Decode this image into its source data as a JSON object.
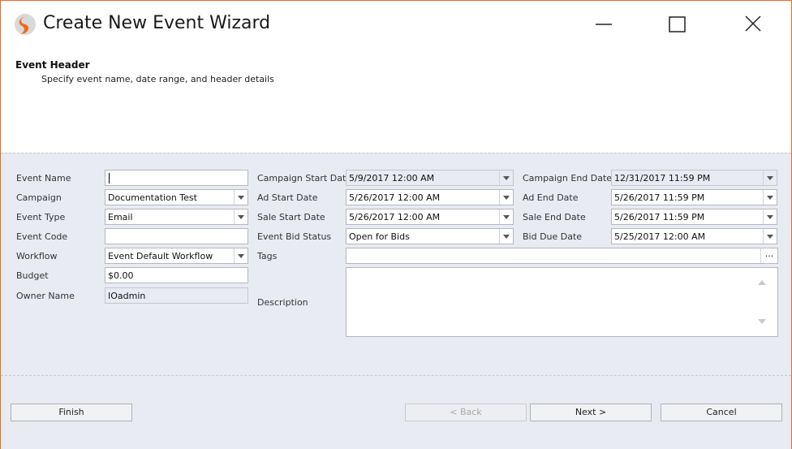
{
  "window": {
    "title": "Create New Event Wizard"
  },
  "header": {
    "title": "Event Header",
    "subtitle": "Specify event name, date range, and header details"
  },
  "form": {
    "event_name": {
      "label": "Event Name",
      "value": ""
    },
    "campaign": {
      "label": "Campaign",
      "value": "Documentation Test"
    },
    "event_type": {
      "label": "Event Type",
      "value": "Email"
    },
    "event_code": {
      "label": "Event Code",
      "value": ""
    },
    "workflow": {
      "label": "Workflow",
      "value": "Event Default Workflow"
    },
    "budget": {
      "label": "Budget",
      "value": "$0.00"
    },
    "owner_name": {
      "label": "Owner Name",
      "value": "IOadmin"
    },
    "campaign_start_date": {
      "label": "Campaign Start Date",
      "value": "5/9/2017 12:00 AM"
    },
    "ad_start_date": {
      "label": "Ad Start Date",
      "value": "5/26/2017 12:00 AM"
    },
    "sale_start_date": {
      "label": "Sale Start Date",
      "value": "5/26/2017 12:00 AM"
    },
    "event_bid_status": {
      "label": "Event Bid Status",
      "value": "Open for Bids"
    },
    "tags": {
      "label": "Tags",
      "value": ""
    },
    "description": {
      "label": "Description",
      "value": ""
    },
    "campaign_end_date": {
      "label": "Campaign End Date",
      "value": "12/31/2017 11:59 PM"
    },
    "ad_end_date": {
      "label": "Ad End Date",
      "value": "5/26/2017 11:59 PM"
    },
    "sale_end_date": {
      "label": "Sale End Date",
      "value": "5/26/2017 11:59 PM"
    },
    "bid_due_date": {
      "label": "Bid Due Date",
      "value": "5/25/2017 12:00 AM"
    }
  },
  "buttons": {
    "finish": "Finish",
    "back": "< Back",
    "next": "Next >",
    "cancel": "Cancel",
    "tags_ellipsis": "..."
  },
  "colors": {
    "accent": "#f06a1c",
    "form_bg": "#e8ebf1"
  }
}
